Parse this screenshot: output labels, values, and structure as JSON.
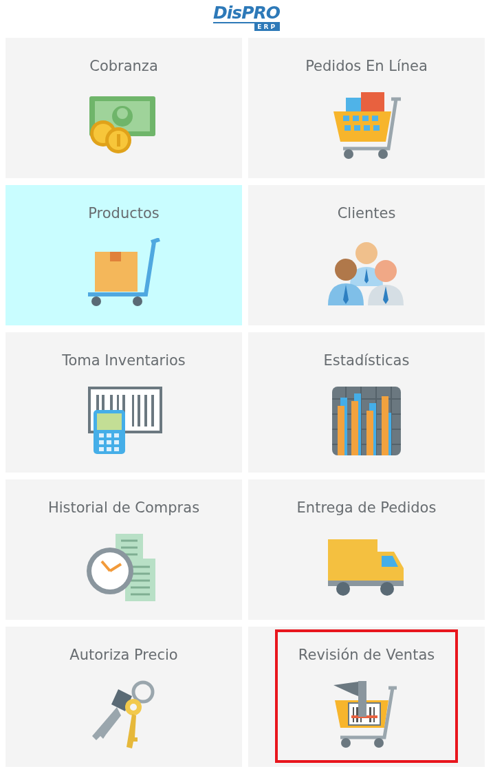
{
  "logo": {
    "name": "DisPRO",
    "suffix": "ERP"
  },
  "tiles": [
    {
      "label": "Cobranza",
      "kind": "money",
      "highlighted": false,
      "focused": false
    },
    {
      "label": "Pedidos En Línea",
      "kind": "cart",
      "highlighted": false,
      "focused": false
    },
    {
      "label": "Productos",
      "kind": "handtruck",
      "highlighted": true,
      "focused": false
    },
    {
      "label": "Clientes",
      "kind": "people",
      "highlighted": false,
      "focused": false
    },
    {
      "label": "Toma Inventarios",
      "kind": "scanner",
      "highlighted": false,
      "focused": false
    },
    {
      "label": "Estadísticas",
      "kind": "chart",
      "highlighted": false,
      "focused": false
    },
    {
      "label": "Historial de Compras",
      "kind": "clock",
      "highlighted": false,
      "focused": false
    },
    {
      "label": "Entrega de Pedidos",
      "kind": "truck",
      "highlighted": false,
      "focused": false
    },
    {
      "label": "Autoriza Precio",
      "kind": "keys",
      "highlighted": false,
      "focused": false
    },
    {
      "label": "Revisión de Ventas",
      "kind": "review",
      "highlighted": false,
      "focused": true
    }
  ]
}
